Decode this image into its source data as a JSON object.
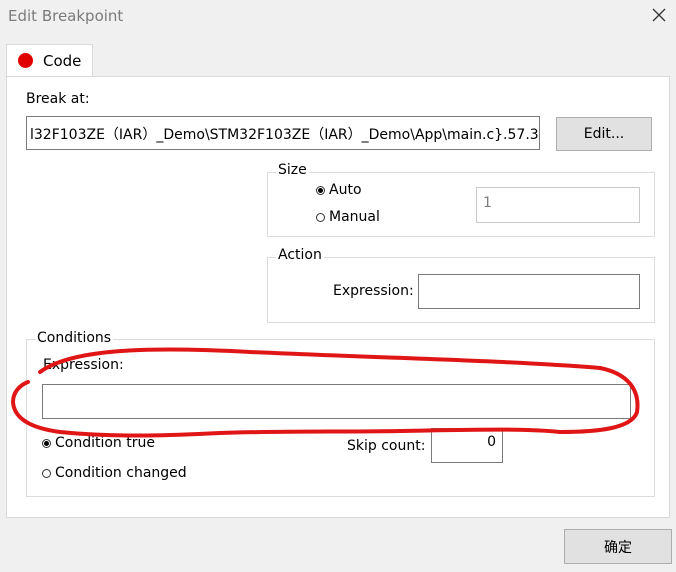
{
  "window": {
    "title": "Edit Breakpoint"
  },
  "tab": {
    "label": "Code"
  },
  "break_at": {
    "label": "Break at:",
    "value": "l32F103ZE（IAR）_Demo\\STM32F103ZE（IAR）_Demo\\App\\main.c}.57.3",
    "edit_button": "Edit..."
  },
  "size": {
    "legend": "Size",
    "options": [
      "Auto",
      "Manual"
    ],
    "selected": "Auto",
    "value": "1"
  },
  "action": {
    "legend": "Action",
    "expression_label": "Expression:",
    "expression_value": ""
  },
  "conditions": {
    "legend": "Conditions",
    "expression_label": "Expression:",
    "expression_value": "",
    "options": [
      "Condition true",
      "Condition changed"
    ],
    "selected": "Condition true",
    "skip_count_label": "Skip count:",
    "skip_count_value": "0"
  },
  "footer": {
    "ok_button": "确定"
  },
  "annotation": {
    "color": "#e01515"
  }
}
